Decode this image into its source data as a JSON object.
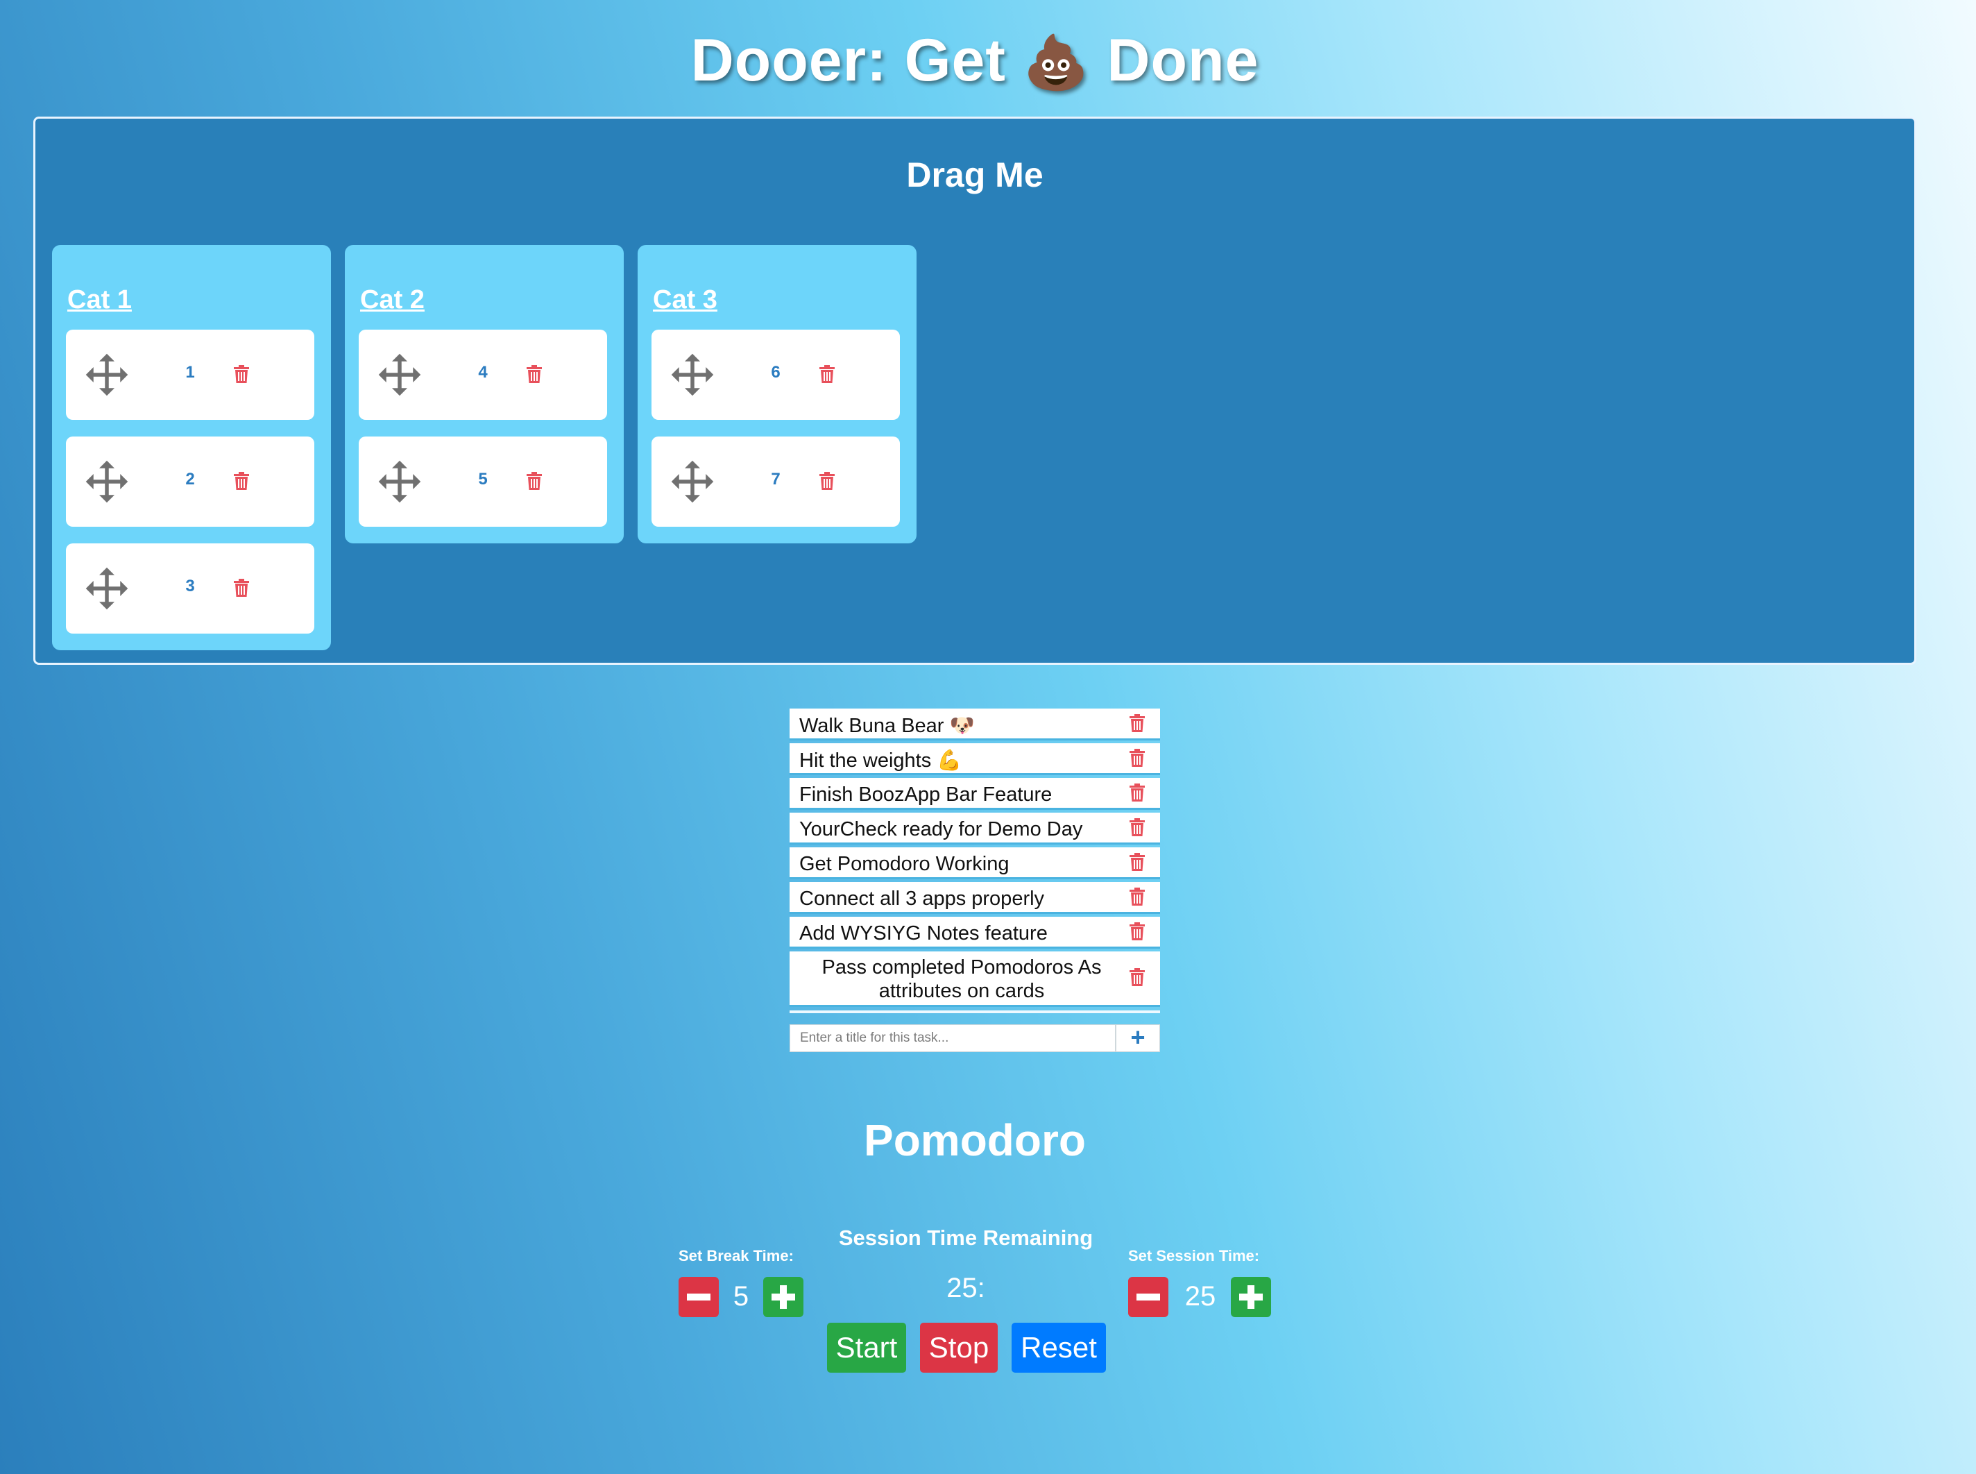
{
  "app": {
    "title_left": "Dooer: Get",
    "title_emoji": "💩",
    "title_right": "Done"
  },
  "board": {
    "title": "Drag Me",
    "categories": [
      {
        "title": "Cat 1",
        "cards": [
          "1",
          "2",
          "3"
        ]
      },
      {
        "title": "Cat 2",
        "cards": [
          "4",
          "5"
        ]
      },
      {
        "title": "Cat 3",
        "cards": [
          "6",
          "7"
        ]
      }
    ]
  },
  "tasks": {
    "items": [
      "Walk Buna Bear 🐶",
      "Hit the weights 💪",
      "Finish BoozApp Bar Feature",
      "YourCheck ready for Demo Day",
      "Get Pomodoro Working",
      "Connect all 3 apps properly",
      "Add WYSIYG Notes feature",
      "Pass completed Pomodoros As attributes on cards"
    ],
    "input_placeholder": "Enter a title for this task...",
    "add_label": "+"
  },
  "pomodoro": {
    "title": "Pomodoro",
    "break_label": "Set Break Time:",
    "break_value": "5",
    "session_label": "Set Session Time:",
    "session_value": "25",
    "remaining_label": "Session Time Remaining",
    "time_display": "25:",
    "start_label": "Start",
    "stop_label": "Stop",
    "reset_label": "Reset"
  },
  "colors": {
    "board_bg": "#2980b9",
    "category_bg": "#6dd5fa",
    "delete": "#e8505b",
    "start": "#28a745",
    "stop": "#dc3545",
    "reset": "#007bff"
  },
  "icons": {
    "card_handle": "move-arrows-icon",
    "delete": "trash-icon",
    "decrement": "minus-icon",
    "increment": "plus-icon"
  }
}
